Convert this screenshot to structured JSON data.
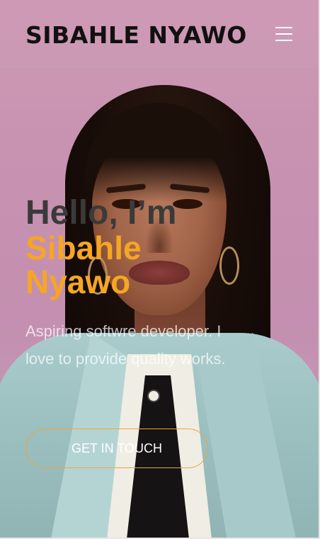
{
  "header": {
    "brand": "SIBAHLE NYAWO",
    "menu_icon": "hamburger-menu-icon"
  },
  "hero": {
    "greeting": "Hello, I’m",
    "name": "Sibahle Nyawo",
    "subtitle": "Aspiring softwre developer. I love to provide quality works.",
    "cta_label": "GET IN TOUCH"
  },
  "colors": {
    "accent": "#f5a623",
    "header_bg": "#cd99b4",
    "greeting_text": "#3a3a3a"
  }
}
